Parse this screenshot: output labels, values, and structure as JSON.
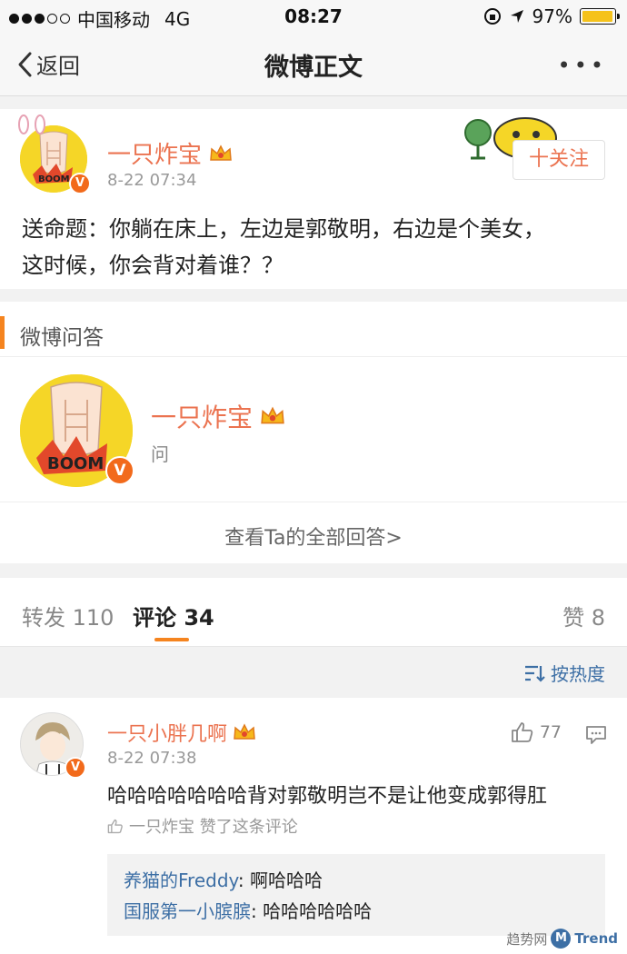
{
  "status_bar": {
    "carrier": "中国移动",
    "network": "4G",
    "time": "08:27",
    "battery": "97%",
    "battery_level": 0.97
  },
  "nav": {
    "back_label": "返回",
    "title": "微博正文",
    "more_label": "•••"
  },
  "post": {
    "author": "一只炸宝",
    "time": "8-22 07:34",
    "follow_label": "十关注",
    "text_line1": "送命题：你躺在床上，左边是郭敬明，右边是个美女，",
    "text_line2": "这时候，你会背对着谁？？"
  },
  "qa": {
    "section_title": "微博问答",
    "author": "一只炸宝",
    "subtitle": "问",
    "view_all": "查看Ta的全部回答>"
  },
  "tabs": {
    "repost": "转发 110",
    "comment": "评论 34",
    "like": "赞 8"
  },
  "sort": {
    "label": "按热度"
  },
  "comment": {
    "author": "一只小胖几啊",
    "time": "8-22 07:38",
    "like_count": "77",
    "text": "哈哈哈哈哈哈哈背对郭敬明岂不是让他变成郭得肛",
    "liked_by": "一只炸宝 赞了这条评论",
    "replies": [
      {
        "who": "养猫的Freddy",
        "what": ": 啊哈哈哈"
      },
      {
        "who": "国服第一小膑膑",
        "what": ": 哈哈哈哈哈哈"
      }
    ]
  },
  "watermark": {
    "text": "趋势网",
    "brand": "Trend",
    "logo_letter": "M"
  },
  "colors": {
    "accent_orange": "#eb7350",
    "link_blue": "#3d6fa5",
    "bar_orange": "#f5841f"
  }
}
